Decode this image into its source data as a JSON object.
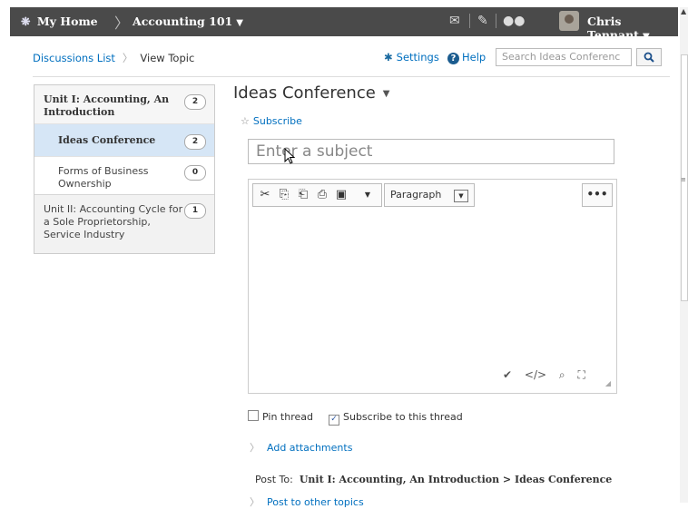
{
  "topbar": {
    "home": "My Home",
    "course": "Accounting 101",
    "user": "Chris Tennant"
  },
  "breadcrumbs": [
    "Discussions List",
    "View Topic"
  ],
  "header_links": {
    "settings": "Settings",
    "help": "Help"
  },
  "search": {
    "placeholder": "Search Ideas Conferenc"
  },
  "sidebar": {
    "items": [
      {
        "label": "Unit I: Accounting, An Introduction",
        "count": "2"
      },
      {
        "label": "Ideas Conference",
        "count": "2"
      },
      {
        "label": "Forms of Business Ownership",
        "count": "0"
      },
      {
        "label": "Unit II: Accounting Cycle for a Sole Proprietorship, Service Industry",
        "count": "1"
      }
    ]
  },
  "main": {
    "title": "Ideas Conference",
    "subscribe": "Subscribe",
    "subject_placeholder": "Enter a subject",
    "editor": {
      "format": "Paragraph"
    },
    "pin_thread": "Pin thread",
    "subscribe_thread": "Subscribe to this thread",
    "add_attachments": "Add attachments",
    "post_to_label": "Post To:",
    "post_to_value": "Unit I: Accounting, An Introduction > Ideas Conference",
    "post_other": "Post to other topics"
  },
  "colors": {
    "topbar": "#4a4a4a",
    "link": "#006fbf",
    "selected": "#d6e6f6"
  }
}
